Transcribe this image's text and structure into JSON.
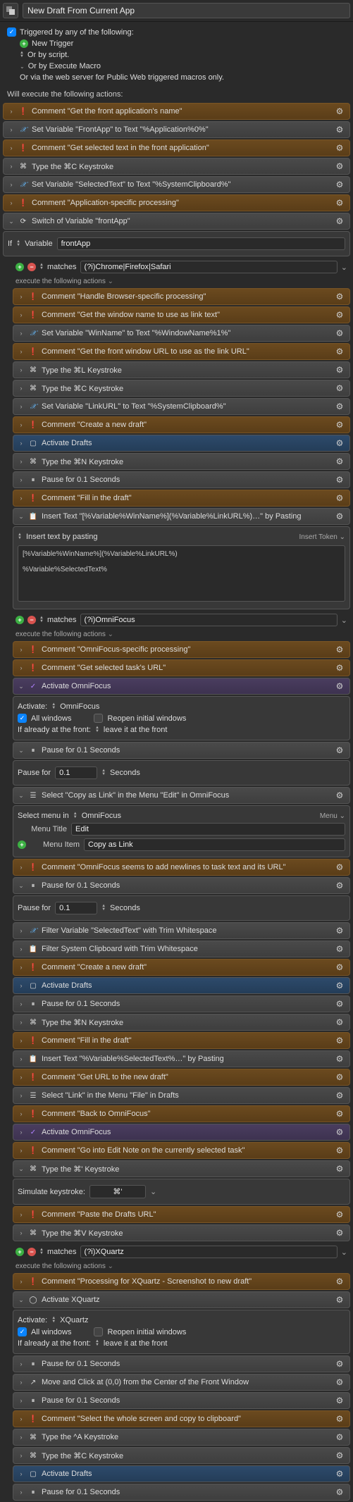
{
  "title": "New Draft From Current App",
  "triggers": {
    "header": "Triggered by any of the following:",
    "new_trigger": "New Trigger",
    "or_script": "Or by script.",
    "or_execute": "Or by Execute Macro",
    "or_web": "Or via the web server for Public Web triggered macros only."
  },
  "exec_header": "Will execute the following actions:",
  "a": {
    "c_get_app": "Comment \"Get the front application's name\"",
    "set_frontapp": "Set Variable \"FrontApp\" to Text \"%Application%0%\"",
    "c_get_sel": "Comment \"Get selected text in the front application\"",
    "type_cmdc": "Type the ⌘C Keystroke",
    "set_seltext": "Set Variable \"SelectedText\" to Text \"%SystemClipboard%\"",
    "c_appspec": "Comment \"Application-specific processing\"",
    "switch": "Switch of Variable \"frontApp\"",
    "if_label": "If",
    "var_label": "Variable",
    "var_frontapp": "frontApp",
    "matches": "matches",
    "regex_browser": "(?i)Chrome|Firefox|Safari",
    "exec_following": "execute the following actions",
    "c_browser": "Comment \"Handle Browser-specific processing\"",
    "c_winname": "Comment \"Get the window name to use as link text\"",
    "set_winname": "Set Variable \"WinName\" to Text \"%WindowName%1%\"",
    "c_fronturl": "Comment \"Get the front window URL to use as the link URL\"",
    "type_cmdl": "Type the ⌘L Keystroke",
    "type_cmdc2": "Type the ⌘C Keystroke",
    "set_linkurl": "Set Variable \"LinkURL\" to Text \"%SystemClipboard%\"",
    "c_newdraft": "Comment \"Create a new draft\"",
    "act_drafts": "Activate Drafts",
    "type_cmdn": "Type the ⌘N Keystroke",
    "pause01": "Pause for 0.1 Seconds",
    "c_filldraft": "Comment \"Fill in the draft\"",
    "insert_browser": "Insert Text \"[%Variable%WinName%](%Variable%LinkURL%)…\" by Pasting",
    "insert_pasting": "Insert text by pasting",
    "insert_token": "Insert Token",
    "insert_content": "[%Variable%WinName%](%Variable%LinkURL%)\n\n%Variable%SelectedText%",
    "regex_omni": "(?i)OmniFocus",
    "c_omnispec": "Comment \"OmniFocus-specific processing\"",
    "c_get_taskurl": "Comment \"Get selected task's URL\"",
    "act_omni": "Activate OmniFocus",
    "activate_lbl": "Activate:",
    "omni_app": "OmniFocus",
    "all_windows": "All windows",
    "reopen": "Reopen initial windows",
    "already_front": "If already at the front:",
    "leave_front": "leave it at the front",
    "pause_for": "Pause for",
    "seconds": "Seconds",
    "pause_val": "0.1",
    "sel_copylink": "Select \"Copy as Link\" in the Menu \"Edit\" in OmniFocus",
    "select_menu_in": "Select menu in",
    "menu_btn": "Menu",
    "menu_title_lbl": "Menu Title",
    "menu_title_val": "Edit",
    "menu_item_lbl": "Menu Item",
    "menu_item_val": "Copy as Link",
    "c_omni_newlines": "Comment \"OmniFocus seems to add newlines to task text and its URL\"",
    "filter_var": "Filter Variable \"SelectedText\" with Trim Whitespace",
    "filter_clip": "Filter System Clipboard with Trim Whitespace",
    "insert_seltext": "Insert Text \"%Variable%SelectedText%…\" by Pasting",
    "c_get_url_draft": "Comment \"Get URL to the new draft\"",
    "sel_link_drafts": "Select \"Link\" in the Menu \"File\" in Drafts",
    "c_back_omni": "Comment \"Back to OmniFocus\"",
    "c_edit_note": "Comment \"Go into Edit Note on the currently selected task\"",
    "type_cmdapos": "Type the ⌘' Keystroke",
    "sim_keystroke": "Simulate keystroke:",
    "key_display": "⌘'",
    "c_paste_drafts": "Comment \"Paste the Drafts URL\"",
    "type_cmdv": "Type the ⌘V Keystroke",
    "regex_xquartz": "(?i)XQuartz",
    "c_xquartz": "Comment \"Processing for XQuartz - Screenshot to new draft\"",
    "act_xquartz": "Activate XQuartz",
    "xquartz_app": "XQuartz",
    "move_click": "Move and Click at (0,0) from the Center of the Front Window",
    "c_sel_whole": "Comment \"Select the whole screen and copy to clipboard\"",
    "type_ctrla": "Type the ^A Keystroke"
  }
}
